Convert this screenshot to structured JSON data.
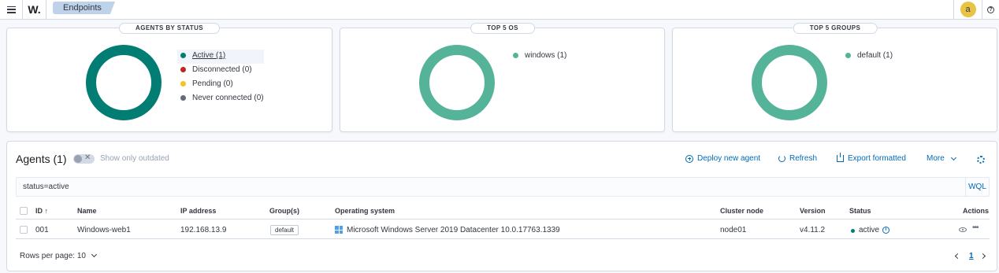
{
  "topbar": {
    "logo": "W.",
    "breadcrumb": "Endpoints",
    "avatar_initial": "a",
    "help_symbol": "?"
  },
  "panels": {
    "status": {
      "title": "AGENTS BY STATUS",
      "items": [
        {
          "label": "Active (1)",
          "color": "#017d73"
        },
        {
          "label": "Disconnected (0)",
          "color": "#bd271e"
        },
        {
          "label": "Pending (0)",
          "color": "#f5c223"
        },
        {
          "label": "Never connected (0)",
          "color": "#646a77"
        }
      ],
      "donut_color": "#017d73"
    },
    "os": {
      "title": "TOP 5 OS",
      "items": [
        {
          "label": "windows (1)",
          "color": "#54b399"
        }
      ],
      "donut_color": "#54b399"
    },
    "groups": {
      "title": "TOP 5 GROUPS",
      "items": [
        {
          "label": "default (1)",
          "color": "#54b399"
        }
      ],
      "donut_color": "#54b399"
    }
  },
  "agents": {
    "title": "Agents (1)",
    "toggle_label": "Show only outdated",
    "actions": {
      "deploy": "Deploy new agent",
      "refresh": "Refresh",
      "export": "Export formatted",
      "more": "More"
    },
    "search_value": "status=active",
    "wql": "WQL",
    "columns": [
      "ID",
      "Name",
      "IP address",
      "Group(s)",
      "Operating system",
      "Cluster node",
      "Version",
      "Status",
      "Actions"
    ],
    "sort_indicator": "↑",
    "rows": [
      {
        "id": "001",
        "name": "Windows-web1",
        "ip": "192.168.13.9",
        "group": "default",
        "os": "Microsoft Windows Server 2019 Datacenter 10.0.17763.1339",
        "cluster_node": "node01",
        "version": "v4.11.2",
        "status": "active"
      }
    ],
    "rows_per_page": "Rows per page: 10",
    "current_page": "1"
  }
}
